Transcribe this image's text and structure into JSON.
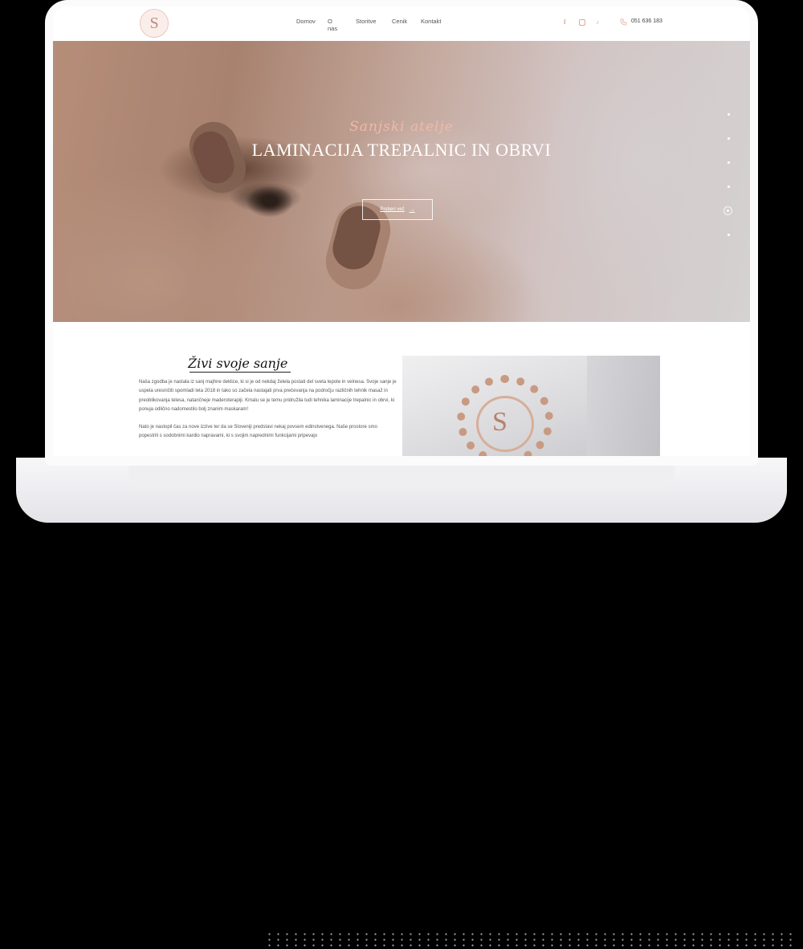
{
  "brand": {
    "logo_letter": "S"
  },
  "nav": {
    "items": [
      "Domov",
      "O nas",
      "Storitve",
      "Cenik",
      "Kontakt"
    ]
  },
  "contact": {
    "phone": "051 636 183"
  },
  "social": {
    "facebook": "f",
    "tiktok": "♪"
  },
  "hero": {
    "subtitle": "Sanjski atelje",
    "title": "LAMINACIJA TREPALNIC IN OBRVI",
    "button_label": "Preberi več",
    "button_arrow": "→",
    "slides_total": 6,
    "active_slide": 5
  },
  "about": {
    "heading": "Živi svoje sanje",
    "paragraphs": [
      "Naša zgodba je nastala iz sanj majhne deklice, ki si je od nekdaj želela postati del sveta lepote in velnesa. Svoje sanje je uspela uresničiti spomladi leta 2018 in tako so začela nastajati prva prečevanja na področju različnih tehnik masaž in preoblikovanja telesa, natančneje maderoterapiji. Kmalu se je temu pridružila tudi tehnika laminacije trepalnic in obrvi, ki ponuja odlično nadomestilo bolj znanim maskaram!",
      "Nato je nastopil čas za nove izzive ter da se Sloveniji predstavi nekaj povsem edinstvenega. Naše prostore smo popestrili s sodobnimi kardio napravami, ki s svojim naprednimi funkcijami pripevajo"
    ],
    "image_letter": "S"
  },
  "colors": {
    "accent": "#e4a493",
    "script": "#efb9a8",
    "text": "#555555"
  }
}
